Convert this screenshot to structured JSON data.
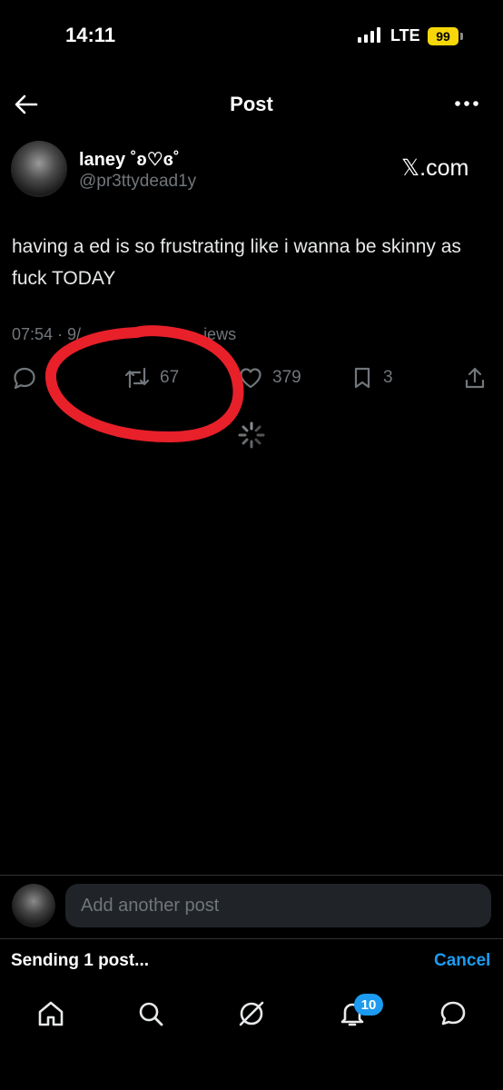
{
  "status_bar": {
    "time": "14:11",
    "network": "LTE",
    "battery": "99"
  },
  "header": {
    "title": "Post"
  },
  "author": {
    "name": "laney ˚ʚ♡ɞ˚",
    "handle": "@pr3ttydead1y"
  },
  "brand": "𝕏.com",
  "post": {
    "text": "having a ed is so frustrating like i wanna be skinny as fuck TODAY",
    "time": "07:54 · 9/",
    "views_suffix": "iews"
  },
  "actions": {
    "reposts": "67",
    "likes": "379",
    "bookmarks": "3"
  },
  "compose": {
    "placeholder": "Add another post"
  },
  "upload": {
    "status": "Sending 1 post...",
    "cancel_label": "Cancel"
  },
  "tabbar": {
    "notifications_badge": "10"
  },
  "colors": {
    "accent": "#1d9bf0",
    "annotation": "#e8202a",
    "battery": "#f6d70a"
  }
}
